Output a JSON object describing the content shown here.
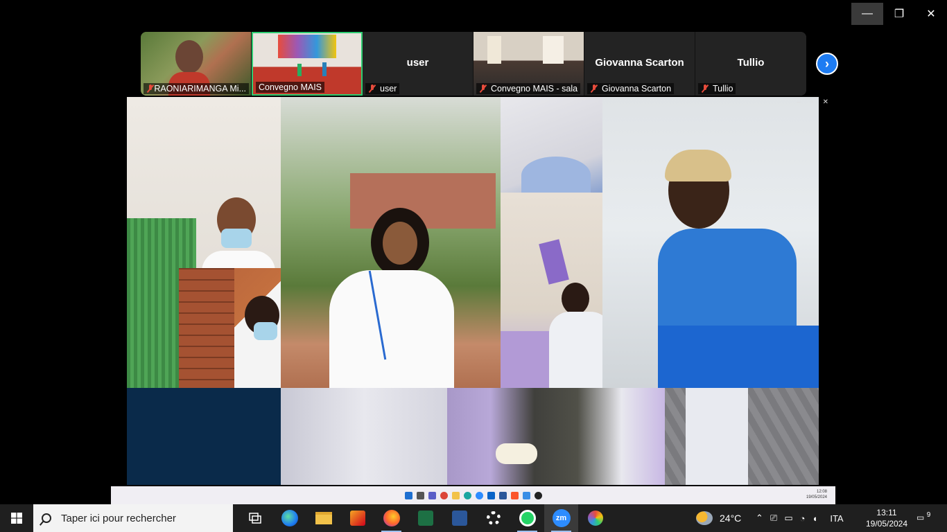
{
  "window_controls": {
    "minimize": "—",
    "restore": "❐",
    "close": "✕"
  },
  "participants": [
    {
      "name": "",
      "label": "RAONIARIMANGA Mi...",
      "video": true,
      "active": false,
      "muted": true
    },
    {
      "name": "",
      "label": "Convegno MAIS",
      "video": true,
      "active": true,
      "muted": false
    },
    {
      "name": "user",
      "label": "user",
      "video": false,
      "active": false,
      "muted": true
    },
    {
      "name": "",
      "label": "Convegno MAIS - sala",
      "video": true,
      "active": false,
      "muted": true
    },
    {
      "name": "Giovanna Scarton",
      "label": "Giovanna Scarton",
      "video": false,
      "active": false,
      "muted": true
    },
    {
      "name": "Tullio",
      "label": "Tullio",
      "video": false,
      "active": false,
      "muted": true
    }
  ],
  "next_arrow": "›",
  "share_window": {
    "minimize": "–",
    "restore": "▫",
    "close": "✕"
  },
  "inner_taskbar": {
    "time": "12:08",
    "date": "19/05/2024"
  },
  "taskbar": {
    "search_placeholder": "Taper ici pour rechercher",
    "weather": "24°C",
    "language": "ITA",
    "time": "13:11",
    "date": "19/05/2024",
    "notifications": "9"
  },
  "colors": {
    "active_border": "#2ecc71",
    "next_button": "#1e7cf2",
    "mic_off": "#e74c3c",
    "taskbar_bg": "#1f1f1f"
  }
}
